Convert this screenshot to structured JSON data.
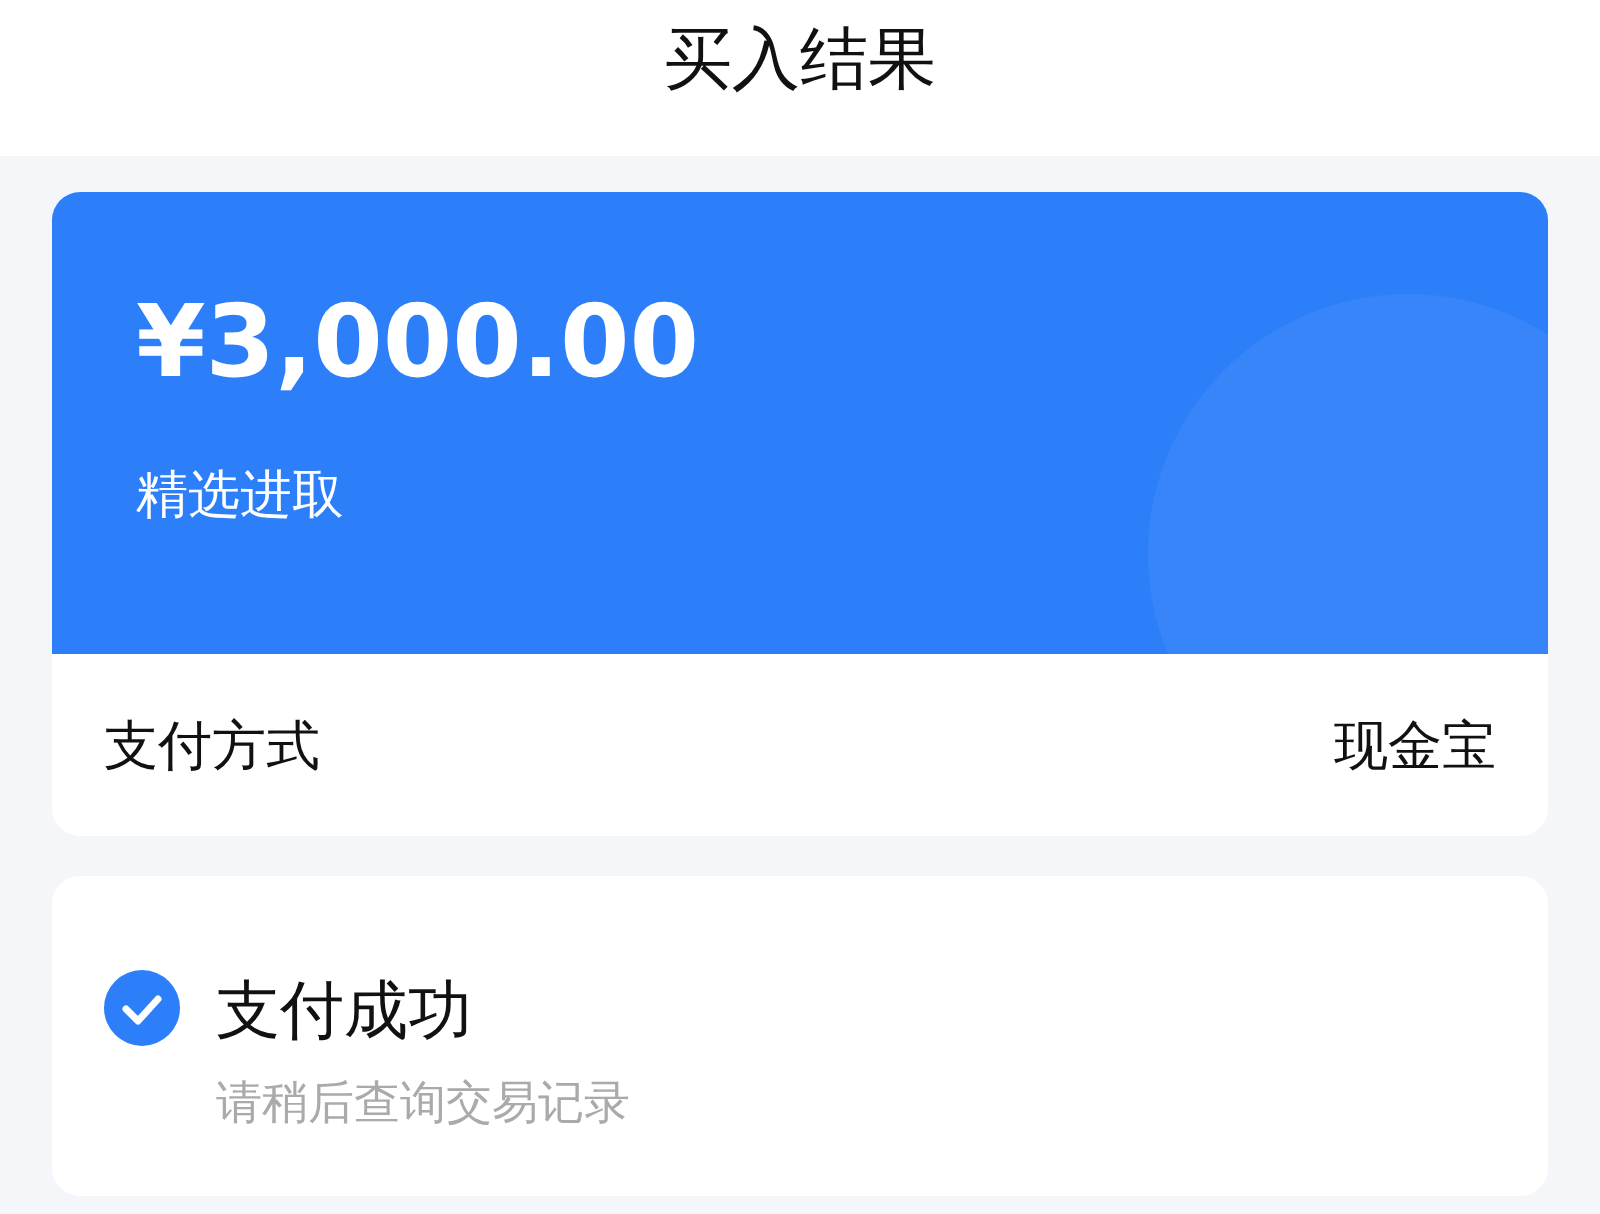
{
  "header": {
    "title": "买入结果"
  },
  "order": {
    "amount": "¥3,000.00",
    "fund_name": "精选进取",
    "payment_label": "支付方式",
    "payment_value": "现金宝"
  },
  "status": {
    "title": "支付成功",
    "subtitle": "请稍后查询交易记录",
    "success": true
  }
}
